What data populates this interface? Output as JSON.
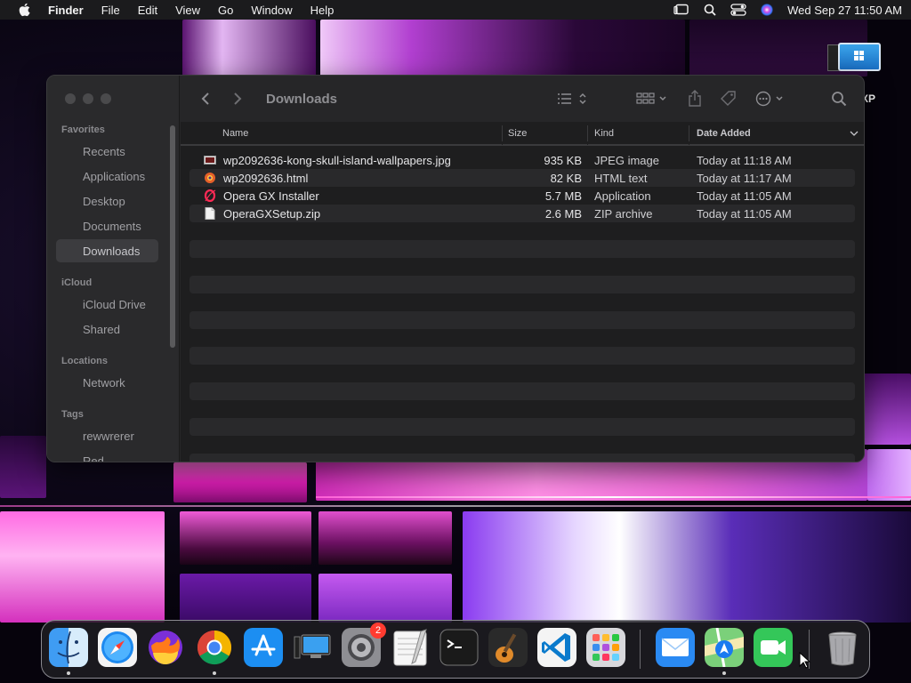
{
  "menubar": {
    "app_name": "Finder",
    "menus": [
      "File",
      "Edit",
      "View",
      "Go",
      "Window",
      "Help"
    ],
    "datetime": "Wed Sep 27  11:50 AM"
  },
  "desktop": {
    "item_label": "XP"
  },
  "finder": {
    "title": "Downloads",
    "sidebar": {
      "favorites_header": "Favorites",
      "favorites": [
        "Recents",
        "Applications",
        "Desktop",
        "Documents",
        "Downloads"
      ],
      "icloud_header": "iCloud",
      "icloud": [
        "iCloud Drive",
        "Shared"
      ],
      "locations_header": "Locations",
      "locations": [
        "Network"
      ],
      "tags_header": "Tags",
      "tags": [
        "rewwrerer",
        "Red"
      ]
    },
    "columns": {
      "name": "Name",
      "size": "Size",
      "kind": "Kind",
      "date_added": "Date Added"
    },
    "files": [
      {
        "name": "wp2092636-kong-skull-island-wallpapers.jpg",
        "size": "935 KB",
        "kind": "JPEG image",
        "date": "Today at 11:18 AM",
        "icon": "jpeg-file-icon"
      },
      {
        "name": "wp2092636.html",
        "size": "82 KB",
        "kind": "HTML text",
        "date": "Today at 11:17 AM",
        "icon": "html-file-icon"
      },
      {
        "name": "Opera GX Installer",
        "size": "5.7 MB",
        "kind": "Application",
        "date": "Today at 11:05 AM",
        "icon": "opera-gx-icon"
      },
      {
        "name": "OperaGXSetup.zip",
        "size": "2.6 MB",
        "kind": "ZIP archive",
        "date": "Today at 11:05 AM",
        "icon": "zip-file-icon"
      }
    ]
  },
  "dock": {
    "apps": [
      "Finder",
      "Safari",
      "Firefox",
      "Chrome",
      "App Store",
      "Screen Sharing",
      "System Settings",
      "TextEdit",
      "Terminal",
      "GarageBand",
      "Visual Studio Code",
      "Launchpad",
      "Mail",
      "Maps",
      "FaceTime",
      "Trash"
    ],
    "system_settings_badge": "2"
  },
  "colors": {
    "menubar_bg": "#1b1b1d",
    "window_bg": "#1e1e1f",
    "sidebar_bg": "#2a2a2c",
    "accent_pink": "#ff5fd8"
  }
}
